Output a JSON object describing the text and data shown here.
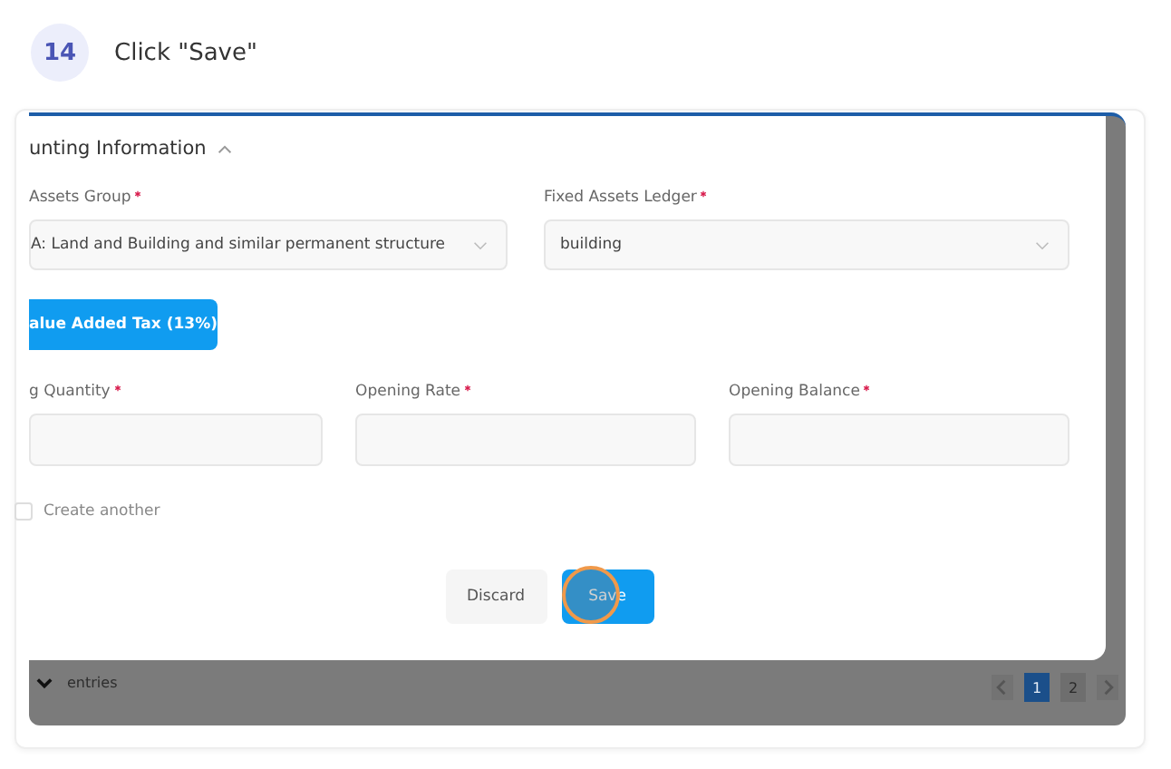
{
  "step": {
    "number": "14",
    "instruction": "Click \"Save\""
  },
  "modal": {
    "section_title": "unting Information",
    "expanded": true,
    "selects": [
      {
        "label": "Assets Group",
        "required": true,
        "value": "A: Land and Building and similar permanent structure"
      },
      {
        "label": "Fixed Assets Ledger",
        "required": true,
        "value": "building"
      }
    ],
    "tax_button": "alue Added Tax (13%)",
    "inputs": [
      {
        "label": "g Quantity",
        "required": true
      },
      {
        "label": "Opening Rate",
        "required": true
      },
      {
        "label": "Opening Balance",
        "required": true
      }
    ],
    "create_another": {
      "label": "Create another",
      "checked": false
    },
    "buttons": [
      {
        "label": "Discard",
        "kind": "secondary",
        "highlighted": false
      },
      {
        "label": "Save",
        "kind": "primary",
        "highlighted": true
      }
    ]
  },
  "background": {
    "entries_label": "entries",
    "pages": [
      {
        "label": "1",
        "selected": true
      },
      {
        "label": "2",
        "selected": false
      }
    ]
  }
}
